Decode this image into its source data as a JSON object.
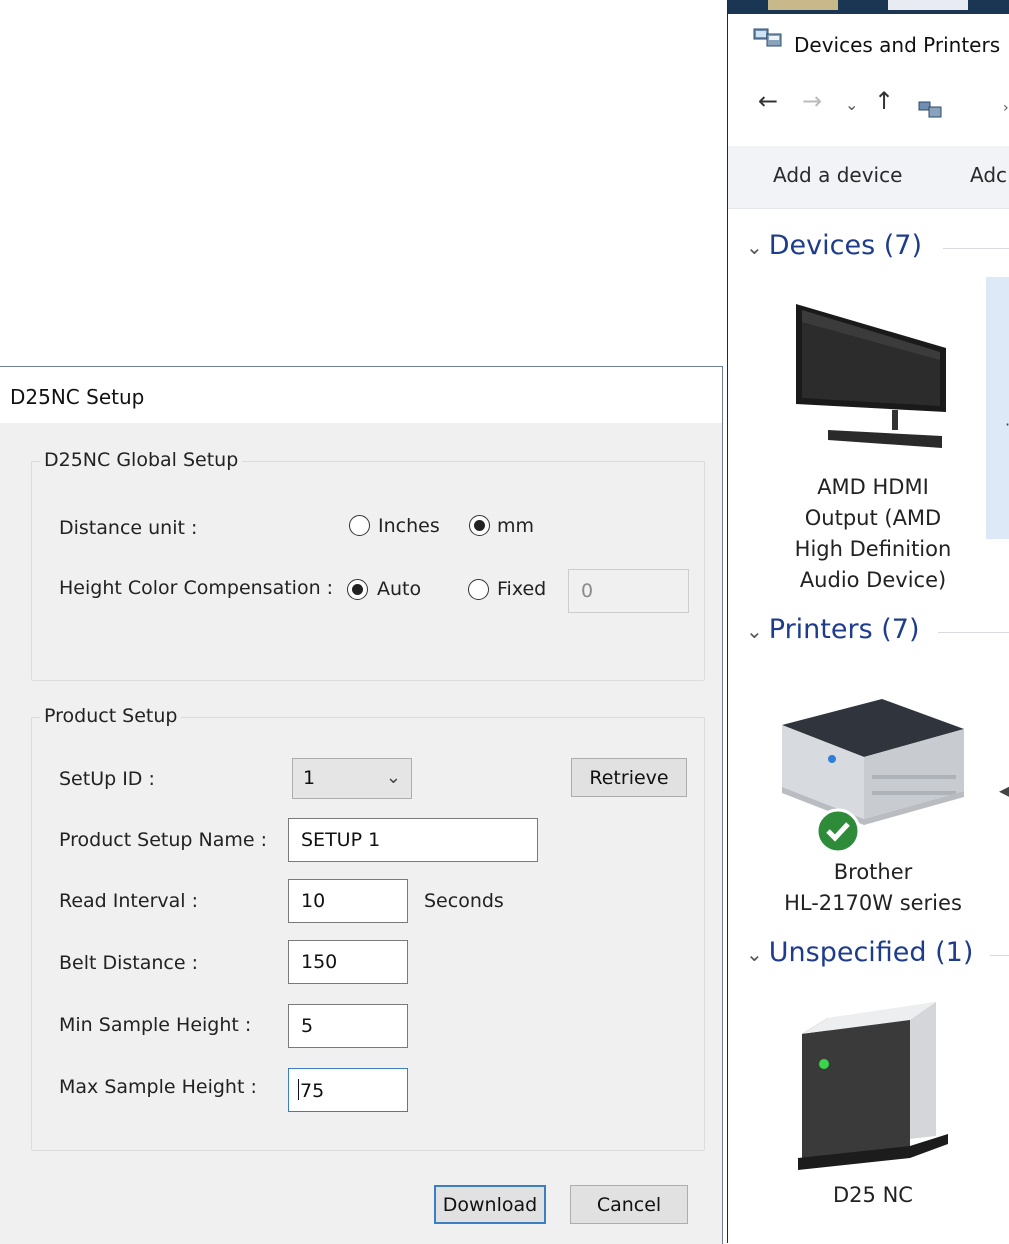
{
  "explorer": {
    "title": "Devices and Printers",
    "nav": {
      "back_icon": "back-arrow-icon",
      "forward_icon": "forward-arrow-icon",
      "recent_icon": "chevron-down-icon",
      "up_icon": "up-arrow-icon",
      "breadcrumb_sep": "›"
    },
    "commands": {
      "add_device": "Add a device",
      "add_printer_partial": "Adc"
    },
    "groups": {
      "devices": {
        "header": "Devices (7)"
      },
      "printers": {
        "header": "Printers (7)"
      },
      "unspecified": {
        "header": "Unspecified (1)"
      }
    },
    "items": {
      "hdmi": {
        "line1": "AMD HDMI",
        "line2": "Output (AMD",
        "line3": "High Definition",
        "line4": "Audio Device)",
        "icon": "monitor-icon"
      },
      "printer": {
        "line1": "Brother",
        "line2": "HL-2170W series",
        "icon": "printer-icon",
        "badge": "default-check-icon"
      },
      "d25": {
        "label": "D25 NC",
        "icon": "device-tower-icon"
      }
    }
  },
  "dialog": {
    "title": "D25NC  Setup",
    "global": {
      "legend": "D25NC Global Setup",
      "distance_label": "Distance unit :",
      "opt_inches": "Inches",
      "opt_mm": "mm",
      "distance_selected": "mm",
      "height_label": "Height Color Compensation :",
      "opt_auto": "Auto",
      "opt_fixed": "Fixed",
      "height_selected": "Auto",
      "fixed_value": "0"
    },
    "product": {
      "legend": "Product Setup",
      "setup_id_label": "SetUp ID :",
      "setup_id_value": "1",
      "retrieve": "Retrieve",
      "name_label": "Product Setup Name :",
      "name_value": "SETUP 1",
      "read_label": "Read Interval :",
      "read_value": "10",
      "read_unit": "Seconds",
      "belt_label": "Belt Distance :",
      "belt_value": "150",
      "min_label": "Min Sample Height :",
      "min_value": "5",
      "max_label": "Max Sample Height :",
      "max_value": "75"
    },
    "buttons": {
      "download": "Download",
      "cancel": "Cancel"
    }
  }
}
